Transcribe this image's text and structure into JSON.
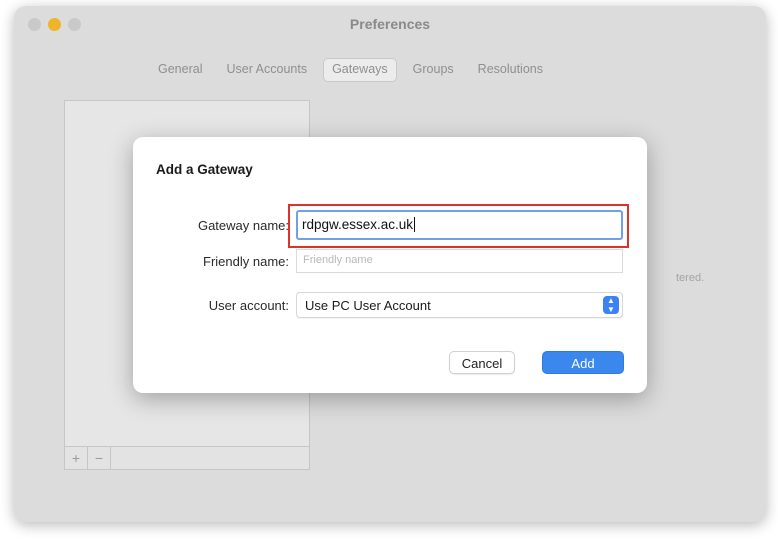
{
  "window": {
    "title": "Preferences",
    "tabs": [
      "General",
      "User Accounts",
      "Gateways",
      "Groups",
      "Resolutions"
    ],
    "active_tab": "Gateways"
  },
  "side_panel": {
    "add_label": "+",
    "remove_label": "−"
  },
  "background_note": "tered.",
  "dialog": {
    "title": "Add a Gateway",
    "gateway_name_label": "Gateway name:",
    "gateway_name_value": "rdpgw.essex.ac.uk",
    "friendly_name_label": "Friendly name:",
    "friendly_name_placeholder": "Friendly name",
    "user_account_label": "User account:",
    "user_account_value": "Use PC User Account",
    "cancel_label": "Cancel",
    "add_label": "Add"
  },
  "colors": {
    "accent": "#3a88ee",
    "highlight": "#e0302a",
    "focus_ring": "#6ea1e6"
  }
}
